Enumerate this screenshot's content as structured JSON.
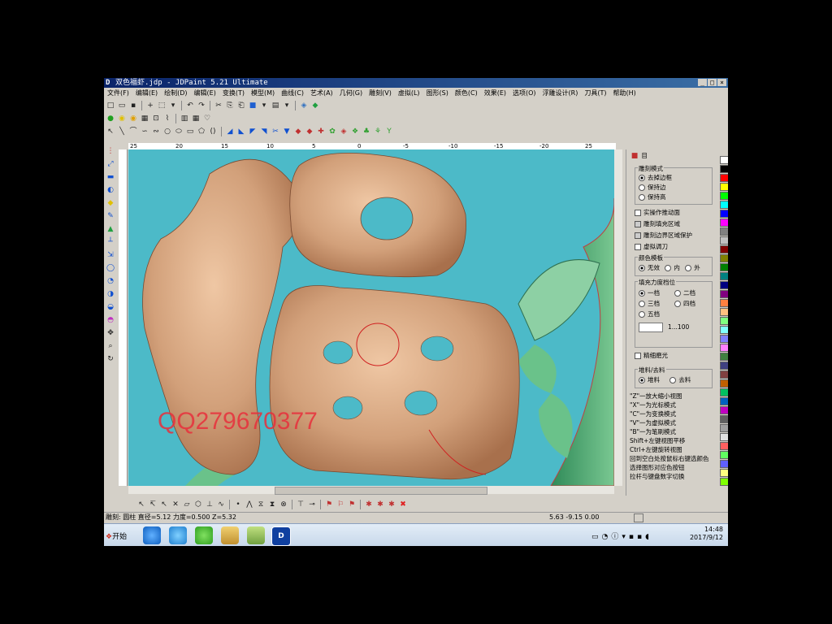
{
  "window": {
    "title": "双色福虾.jdp - JDPaint 5.21 Ultimate",
    "logo": "D"
  },
  "menu": [
    "文件(F)",
    "编辑(E)",
    "绘制(D)",
    "编辑(E)",
    "变换(T)",
    "模型(M)",
    "曲线(C)",
    "艺术(A)",
    "几何(G)",
    "雕刻(V)",
    "虚拟(L)",
    "图形(S)",
    "颜色(C)",
    "效果(E)",
    "选项(O)",
    "浮雕设计(R)",
    "刀具(T)",
    "帮助(H)"
  ],
  "ruler": {
    "labels": [
      "25",
      "20",
      "15",
      "10",
      "5",
      "0",
      "-5",
      "-10",
      "-15",
      "-20",
      "25"
    ]
  },
  "watermark": "QQ279670377",
  "panel": {
    "tabs": [
      "目"
    ],
    "group_mode": {
      "title": "雕刻模式",
      "options": [
        "去掉边框",
        "保持边",
        "保持高"
      ],
      "selected": 0
    },
    "checkboxes": [
      {
        "label": "实操作推动面",
        "checked": false
      },
      {
        "label": "雕刻填充区域",
        "checked": true
      },
      {
        "label": "雕刻边界区域保护",
        "checked": true
      },
      {
        "label": "虚拟调刀",
        "checked": false
      }
    ],
    "group_fill": {
      "title": "颜色模板",
      "options": [
        "无效",
        "内",
        "外"
      ],
      "selected": 0
    },
    "group_pos": {
      "title": "填充力度档位",
      "options": [
        "一档",
        "二档",
        "三档",
        "四档",
        "五档"
      ],
      "selected": 0,
      "input_value": "",
      "range": "1...100"
    },
    "check_smooth": {
      "label": "精细磨光",
      "checked": false
    },
    "group_type": {
      "title": "堆料/去料",
      "options": [
        "堆料",
        "去料"
      ],
      "selected": 0
    },
    "help_lines": [
      "\"Z\"一放大缩小视图",
      "\"X\"一为光标模式",
      "\"C\"一为变换模式",
      "\"V\"一为虚拟模式",
      "\"B\"一为笔刷模式",
      "Shift+左键视图平移",
      "Ctrl+左键旋转视图",
      "回到空白处按鼠标右键选颜色",
      "选择图形对应色按钮",
      "拉杆与键盘数字切换"
    ]
  },
  "palette": [
    "#ffffff",
    "#000000",
    "#ff0000",
    "#ffff00",
    "#00ff00",
    "#00ffff",
    "#0000ff",
    "#ff00ff",
    "#808080",
    "#c0c0c0",
    "#800000",
    "#808000",
    "#008000",
    "#008080",
    "#000080",
    "#800080",
    "#ff8040",
    "#ffc080",
    "#80ff80",
    "#80ffff",
    "#8080ff",
    "#ff80ff",
    "#408040",
    "#404080",
    "#804040",
    "#c06000",
    "#00c060",
    "#0060c0",
    "#c000c0",
    "#606060",
    "#a0a0a0",
    "#e0e0e0",
    "#ff6060",
    "#60ff60",
    "#6060ff",
    "#ffff80",
    "#80ff00"
  ],
  "status": {
    "left": "雕刻: 圆柱  直径=5.12  力度=0.500  Z=5.32",
    "coords": "5.63 -9.15 0.00"
  },
  "taskbar": {
    "start": "开始",
    "time": "14:48",
    "date": "2017/9/12"
  }
}
